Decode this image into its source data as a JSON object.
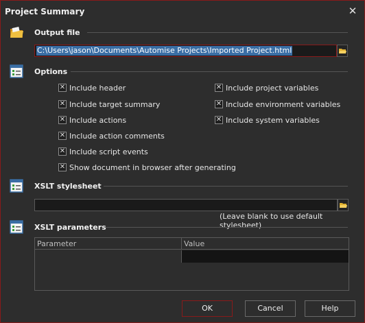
{
  "window": {
    "title": "Project Summary",
    "close_glyph": "✕"
  },
  "output": {
    "title": "Output file",
    "value": "C:\\Users\\jason\\Documents\\Automise Projects\\Imported Project.html"
  },
  "options": {
    "title": "Options",
    "left": [
      {
        "label": "Include header",
        "checked": true
      },
      {
        "label": "Include target summary",
        "checked": true
      },
      {
        "label": "Include actions",
        "checked": true
      },
      {
        "label": "Include action comments",
        "checked": true
      },
      {
        "label": "Include script events",
        "checked": true
      },
      {
        "label": "Show document in browser after generating",
        "checked": true
      }
    ],
    "right": [
      {
        "label": "Include project variables",
        "checked": true
      },
      {
        "label": "Include environment variables",
        "checked": true
      },
      {
        "label": "Include system variables",
        "checked": true
      }
    ]
  },
  "xslt": {
    "title": "XSLT stylesheet",
    "value": "",
    "hint": "(Leave blank to use default stylesheet)"
  },
  "params": {
    "title": "XSLT parameters",
    "columns": [
      "Parameter",
      "Value"
    ]
  },
  "buttons": {
    "ok": "OK",
    "cancel": "Cancel",
    "help": "Help"
  },
  "icons": {
    "section": "checklist-icon",
    "output": "folder-icon",
    "browse": "folder-open-icon"
  },
  "colors": {
    "accent": "#8a1a1a",
    "selection": "#3a6ea5",
    "folder": "#e0b030"
  }
}
